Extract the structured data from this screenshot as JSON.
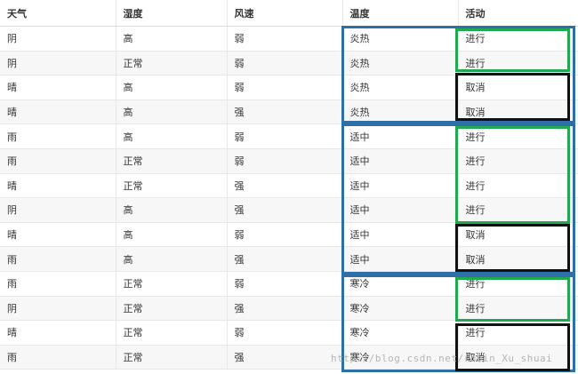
{
  "table": {
    "headers": [
      "天气",
      "湿度",
      "风速",
      "温度",
      "活动"
    ],
    "rows": [
      [
        "阴",
        "高",
        "弱",
        "炎热",
        "进行"
      ],
      [
        "阴",
        "正常",
        "弱",
        "炎热",
        "进行"
      ],
      [
        "晴",
        "高",
        "弱",
        "炎热",
        "取消"
      ],
      [
        "晴",
        "高",
        "强",
        "炎热",
        "取消"
      ],
      [
        "雨",
        "高",
        "弱",
        "适中",
        "进行"
      ],
      [
        "雨",
        "正常",
        "弱",
        "适中",
        "进行"
      ],
      [
        "晴",
        "正常",
        "强",
        "适中",
        "进行"
      ],
      [
        "阴",
        "高",
        "强",
        "适中",
        "进行"
      ],
      [
        "晴",
        "高",
        "弱",
        "适中",
        "取消"
      ],
      [
        "雨",
        "高",
        "强",
        "适中",
        "取消"
      ],
      [
        "雨",
        "正常",
        "弱",
        "寒冷",
        "进行"
      ],
      [
        "阴",
        "正常",
        "强",
        "寒冷",
        "进行"
      ],
      [
        "晴",
        "正常",
        "弱",
        "寒冷",
        "进行"
      ],
      [
        "雨",
        "正常",
        "强",
        "寒冷",
        "取消"
      ]
    ]
  },
  "watermark": "http://blog.csdn.net/robin_Xu_shuai",
  "colors": {
    "blue_box": "#2f6fa8",
    "green_box": "#22a94f",
    "black_box": "#111111"
  }
}
